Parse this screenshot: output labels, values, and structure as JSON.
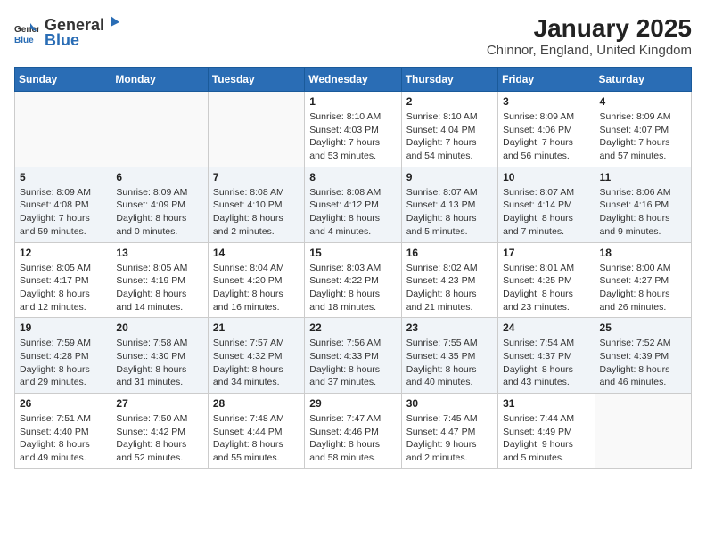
{
  "logo": {
    "general": "General",
    "blue": "Blue"
  },
  "title": "January 2025",
  "subtitle": "Chinnor, England, United Kingdom",
  "days_header": [
    "Sunday",
    "Monday",
    "Tuesday",
    "Wednesday",
    "Thursday",
    "Friday",
    "Saturday"
  ],
  "weeks": [
    [
      {
        "day": "",
        "info": ""
      },
      {
        "day": "",
        "info": ""
      },
      {
        "day": "",
        "info": ""
      },
      {
        "day": "1",
        "info": "Sunrise: 8:10 AM\nSunset: 4:03 PM\nDaylight: 7 hours and 53 minutes."
      },
      {
        "day": "2",
        "info": "Sunrise: 8:10 AM\nSunset: 4:04 PM\nDaylight: 7 hours and 54 minutes."
      },
      {
        "day": "3",
        "info": "Sunrise: 8:09 AM\nSunset: 4:06 PM\nDaylight: 7 hours and 56 minutes."
      },
      {
        "day": "4",
        "info": "Sunrise: 8:09 AM\nSunset: 4:07 PM\nDaylight: 7 hours and 57 minutes."
      }
    ],
    [
      {
        "day": "5",
        "info": "Sunrise: 8:09 AM\nSunset: 4:08 PM\nDaylight: 7 hours and 59 minutes."
      },
      {
        "day": "6",
        "info": "Sunrise: 8:09 AM\nSunset: 4:09 PM\nDaylight: 8 hours and 0 minutes."
      },
      {
        "day": "7",
        "info": "Sunrise: 8:08 AM\nSunset: 4:10 PM\nDaylight: 8 hours and 2 minutes."
      },
      {
        "day": "8",
        "info": "Sunrise: 8:08 AM\nSunset: 4:12 PM\nDaylight: 8 hours and 4 minutes."
      },
      {
        "day": "9",
        "info": "Sunrise: 8:07 AM\nSunset: 4:13 PM\nDaylight: 8 hours and 5 minutes."
      },
      {
        "day": "10",
        "info": "Sunrise: 8:07 AM\nSunset: 4:14 PM\nDaylight: 8 hours and 7 minutes."
      },
      {
        "day": "11",
        "info": "Sunrise: 8:06 AM\nSunset: 4:16 PM\nDaylight: 8 hours and 9 minutes."
      }
    ],
    [
      {
        "day": "12",
        "info": "Sunrise: 8:05 AM\nSunset: 4:17 PM\nDaylight: 8 hours and 12 minutes."
      },
      {
        "day": "13",
        "info": "Sunrise: 8:05 AM\nSunset: 4:19 PM\nDaylight: 8 hours and 14 minutes."
      },
      {
        "day": "14",
        "info": "Sunrise: 8:04 AM\nSunset: 4:20 PM\nDaylight: 8 hours and 16 minutes."
      },
      {
        "day": "15",
        "info": "Sunrise: 8:03 AM\nSunset: 4:22 PM\nDaylight: 8 hours and 18 minutes."
      },
      {
        "day": "16",
        "info": "Sunrise: 8:02 AM\nSunset: 4:23 PM\nDaylight: 8 hours and 21 minutes."
      },
      {
        "day": "17",
        "info": "Sunrise: 8:01 AM\nSunset: 4:25 PM\nDaylight: 8 hours and 23 minutes."
      },
      {
        "day": "18",
        "info": "Sunrise: 8:00 AM\nSunset: 4:27 PM\nDaylight: 8 hours and 26 minutes."
      }
    ],
    [
      {
        "day": "19",
        "info": "Sunrise: 7:59 AM\nSunset: 4:28 PM\nDaylight: 8 hours and 29 minutes."
      },
      {
        "day": "20",
        "info": "Sunrise: 7:58 AM\nSunset: 4:30 PM\nDaylight: 8 hours and 31 minutes."
      },
      {
        "day": "21",
        "info": "Sunrise: 7:57 AM\nSunset: 4:32 PM\nDaylight: 8 hours and 34 minutes."
      },
      {
        "day": "22",
        "info": "Sunrise: 7:56 AM\nSunset: 4:33 PM\nDaylight: 8 hours and 37 minutes."
      },
      {
        "day": "23",
        "info": "Sunrise: 7:55 AM\nSunset: 4:35 PM\nDaylight: 8 hours and 40 minutes."
      },
      {
        "day": "24",
        "info": "Sunrise: 7:54 AM\nSunset: 4:37 PM\nDaylight: 8 hours and 43 minutes."
      },
      {
        "day": "25",
        "info": "Sunrise: 7:52 AM\nSunset: 4:39 PM\nDaylight: 8 hours and 46 minutes."
      }
    ],
    [
      {
        "day": "26",
        "info": "Sunrise: 7:51 AM\nSunset: 4:40 PM\nDaylight: 8 hours and 49 minutes."
      },
      {
        "day": "27",
        "info": "Sunrise: 7:50 AM\nSunset: 4:42 PM\nDaylight: 8 hours and 52 minutes."
      },
      {
        "day": "28",
        "info": "Sunrise: 7:48 AM\nSunset: 4:44 PM\nDaylight: 8 hours and 55 minutes."
      },
      {
        "day": "29",
        "info": "Sunrise: 7:47 AM\nSunset: 4:46 PM\nDaylight: 8 hours and 58 minutes."
      },
      {
        "day": "30",
        "info": "Sunrise: 7:45 AM\nSunset: 4:47 PM\nDaylight: 9 hours and 2 minutes."
      },
      {
        "day": "31",
        "info": "Sunrise: 7:44 AM\nSunset: 4:49 PM\nDaylight: 9 hours and 5 minutes."
      },
      {
        "day": "",
        "info": ""
      }
    ]
  ]
}
